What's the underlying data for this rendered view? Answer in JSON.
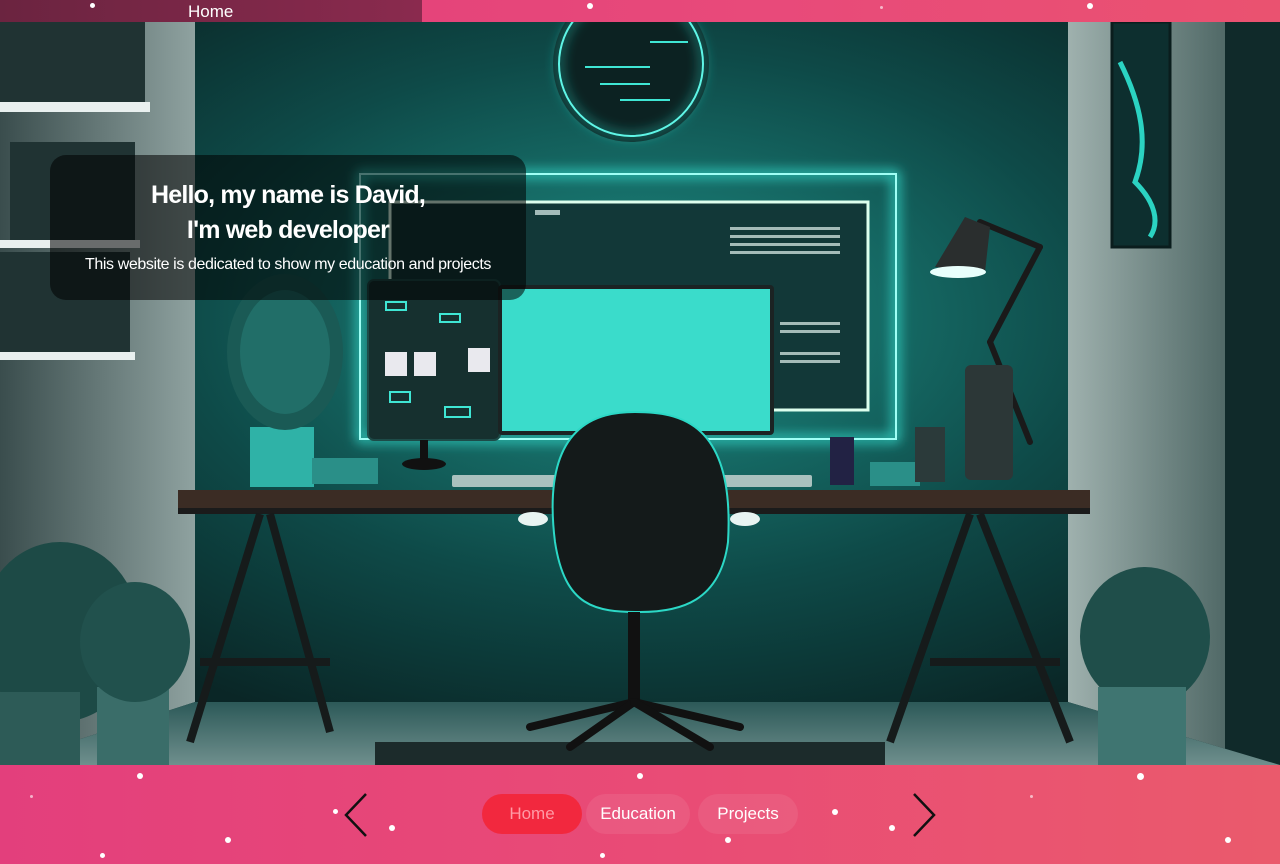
{
  "top_nav": {
    "home_label": "Home"
  },
  "hero": {
    "title_line1": "Hello, my name is David,",
    "title_line2": "I'm web developer",
    "subtitle": "This website is dedicated to show my education and projects",
    "image": "neon-desk-workspace"
  },
  "bottom_nav": {
    "tabs": [
      {
        "label": "Home",
        "active": true
      },
      {
        "label": "Education",
        "active": false
      },
      {
        "label": "Projects",
        "active": false
      }
    ],
    "prev_icon": "chevron-left-icon",
    "next_icon": "chevron-right-icon"
  },
  "colors": {
    "accent": "#f2283e",
    "background_pink": "#e84a78",
    "neon": "#22e6d2"
  }
}
